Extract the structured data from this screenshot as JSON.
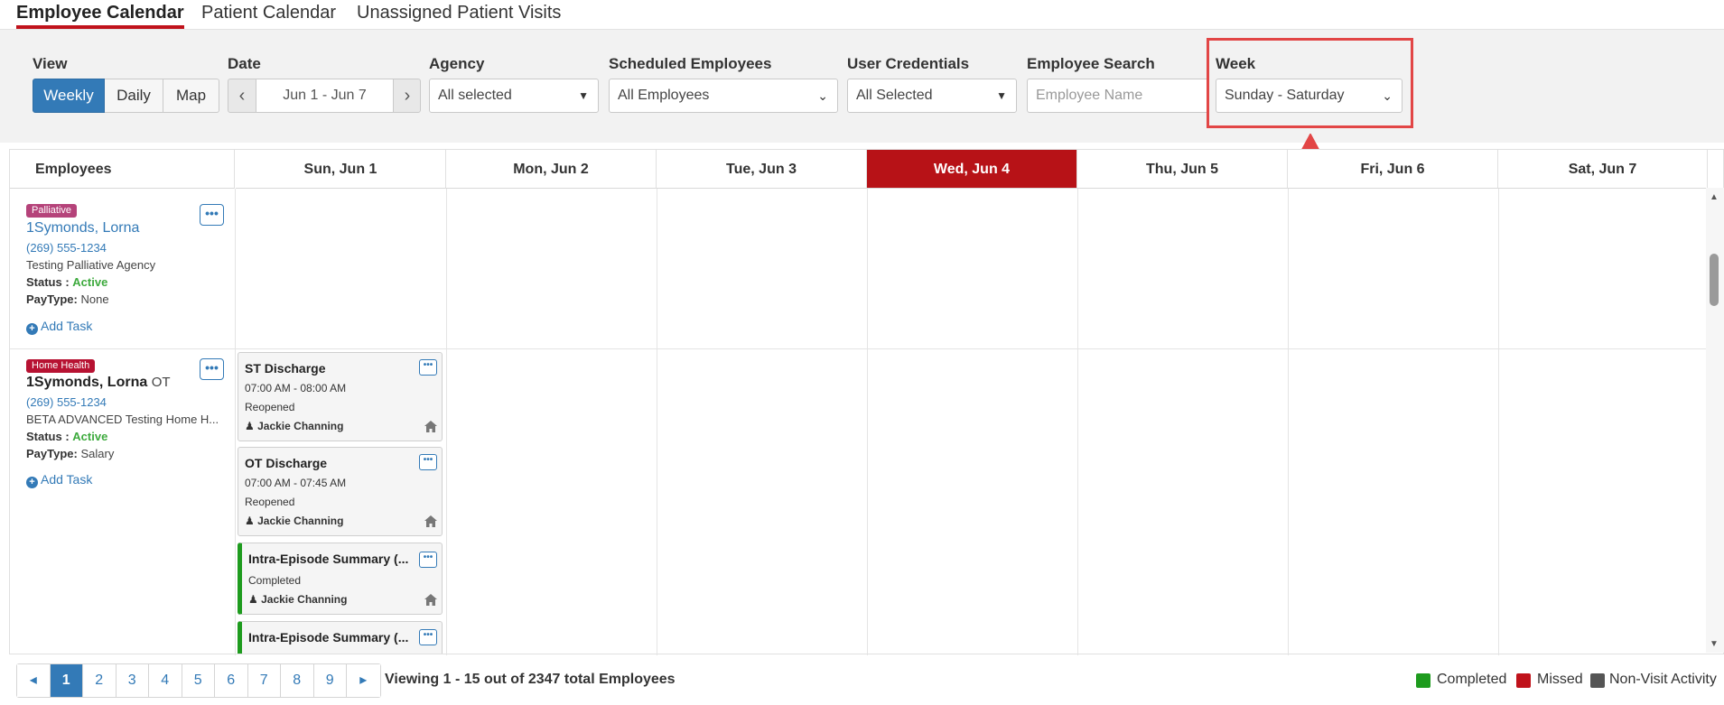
{
  "tabs": [
    {
      "label": "Employee Calendar",
      "active": true
    },
    {
      "label": "Patient Calendar",
      "active": false
    },
    {
      "label": "Unassigned Patient Visits",
      "active": false
    }
  ],
  "filters": {
    "view": {
      "label": "View",
      "options": [
        "Weekly",
        "Daily",
        "Map"
      ],
      "selected": "Weekly"
    },
    "date": {
      "label": "Date",
      "value": "Jun 1 - Jun 7"
    },
    "agency": {
      "label": "Agency",
      "value": "All selected"
    },
    "scheduled": {
      "label": "Scheduled Employees",
      "value": "All Employees"
    },
    "credentials": {
      "label": "User Credentials",
      "value": "All Selected"
    },
    "search": {
      "label": "Employee Search",
      "placeholder": "Employee Name"
    },
    "week": {
      "label": "Week",
      "value": "Sunday - Saturday"
    }
  },
  "calendar": {
    "employees_header": "Employees",
    "days": [
      "Sun, Jun 1",
      "Mon, Jun 2",
      "Tue, Jun 3",
      "Wed, Jun 4",
      "Thu, Jun 5",
      "Fri, Jun 6",
      "Sat, Jun 7"
    ],
    "today": "Wed, Jun 4",
    "employees": [
      {
        "badge": "Palliative",
        "badge_color": "#b5437a",
        "name": "1Symonds, Lorna",
        "credential": "",
        "phone": "(269) 555-1234",
        "agency": "Testing Palliative Agency",
        "status_label": "Status :",
        "status": "Active",
        "paytype_label": "PayType:",
        "paytype": "None",
        "add_task": "Add Task"
      },
      {
        "badge": "Home Health",
        "badge_color": "#b71232",
        "name": "1Symonds, Lorna",
        "credential": "OT",
        "phone": "(269) 555-1234",
        "agency": "BETA ADVANCED Testing Home H...",
        "status_label": "Status :",
        "status": "Active",
        "paytype_label": "PayType:",
        "paytype": "Salary",
        "add_task": "Add Task"
      }
    ],
    "tasks": [
      {
        "title": "ST Discharge",
        "time": "07:00 AM - 08:00 AM",
        "status": "Reopened",
        "assignee": "Jackie Channing"
      },
      {
        "title": "OT Discharge",
        "time": "07:00 AM - 07:45 AM",
        "status": "Reopened",
        "assignee": "Jackie Channing"
      },
      {
        "title": "Intra-Episode Summary (...",
        "status": "Completed",
        "assignee": "Jackie Channing"
      },
      {
        "title": "Intra-Episode Summary (..."
      }
    ]
  },
  "footer": {
    "pages": [
      "1",
      "2",
      "3",
      "4",
      "5",
      "6",
      "7",
      "8",
      "9"
    ],
    "current_page": "1",
    "viewing": "Viewing 1 - 15 out of 2347 total Employees",
    "legend": [
      {
        "label": "Completed",
        "color": "#1e9b1e"
      },
      {
        "label": "Missed",
        "color": "#c0121b"
      },
      {
        "label": "Non-Visit Activity",
        "color": "#555555"
      }
    ]
  },
  "colors": {
    "accent": "#337ab7",
    "today": "#b71217",
    "highlight": "#e24646"
  }
}
